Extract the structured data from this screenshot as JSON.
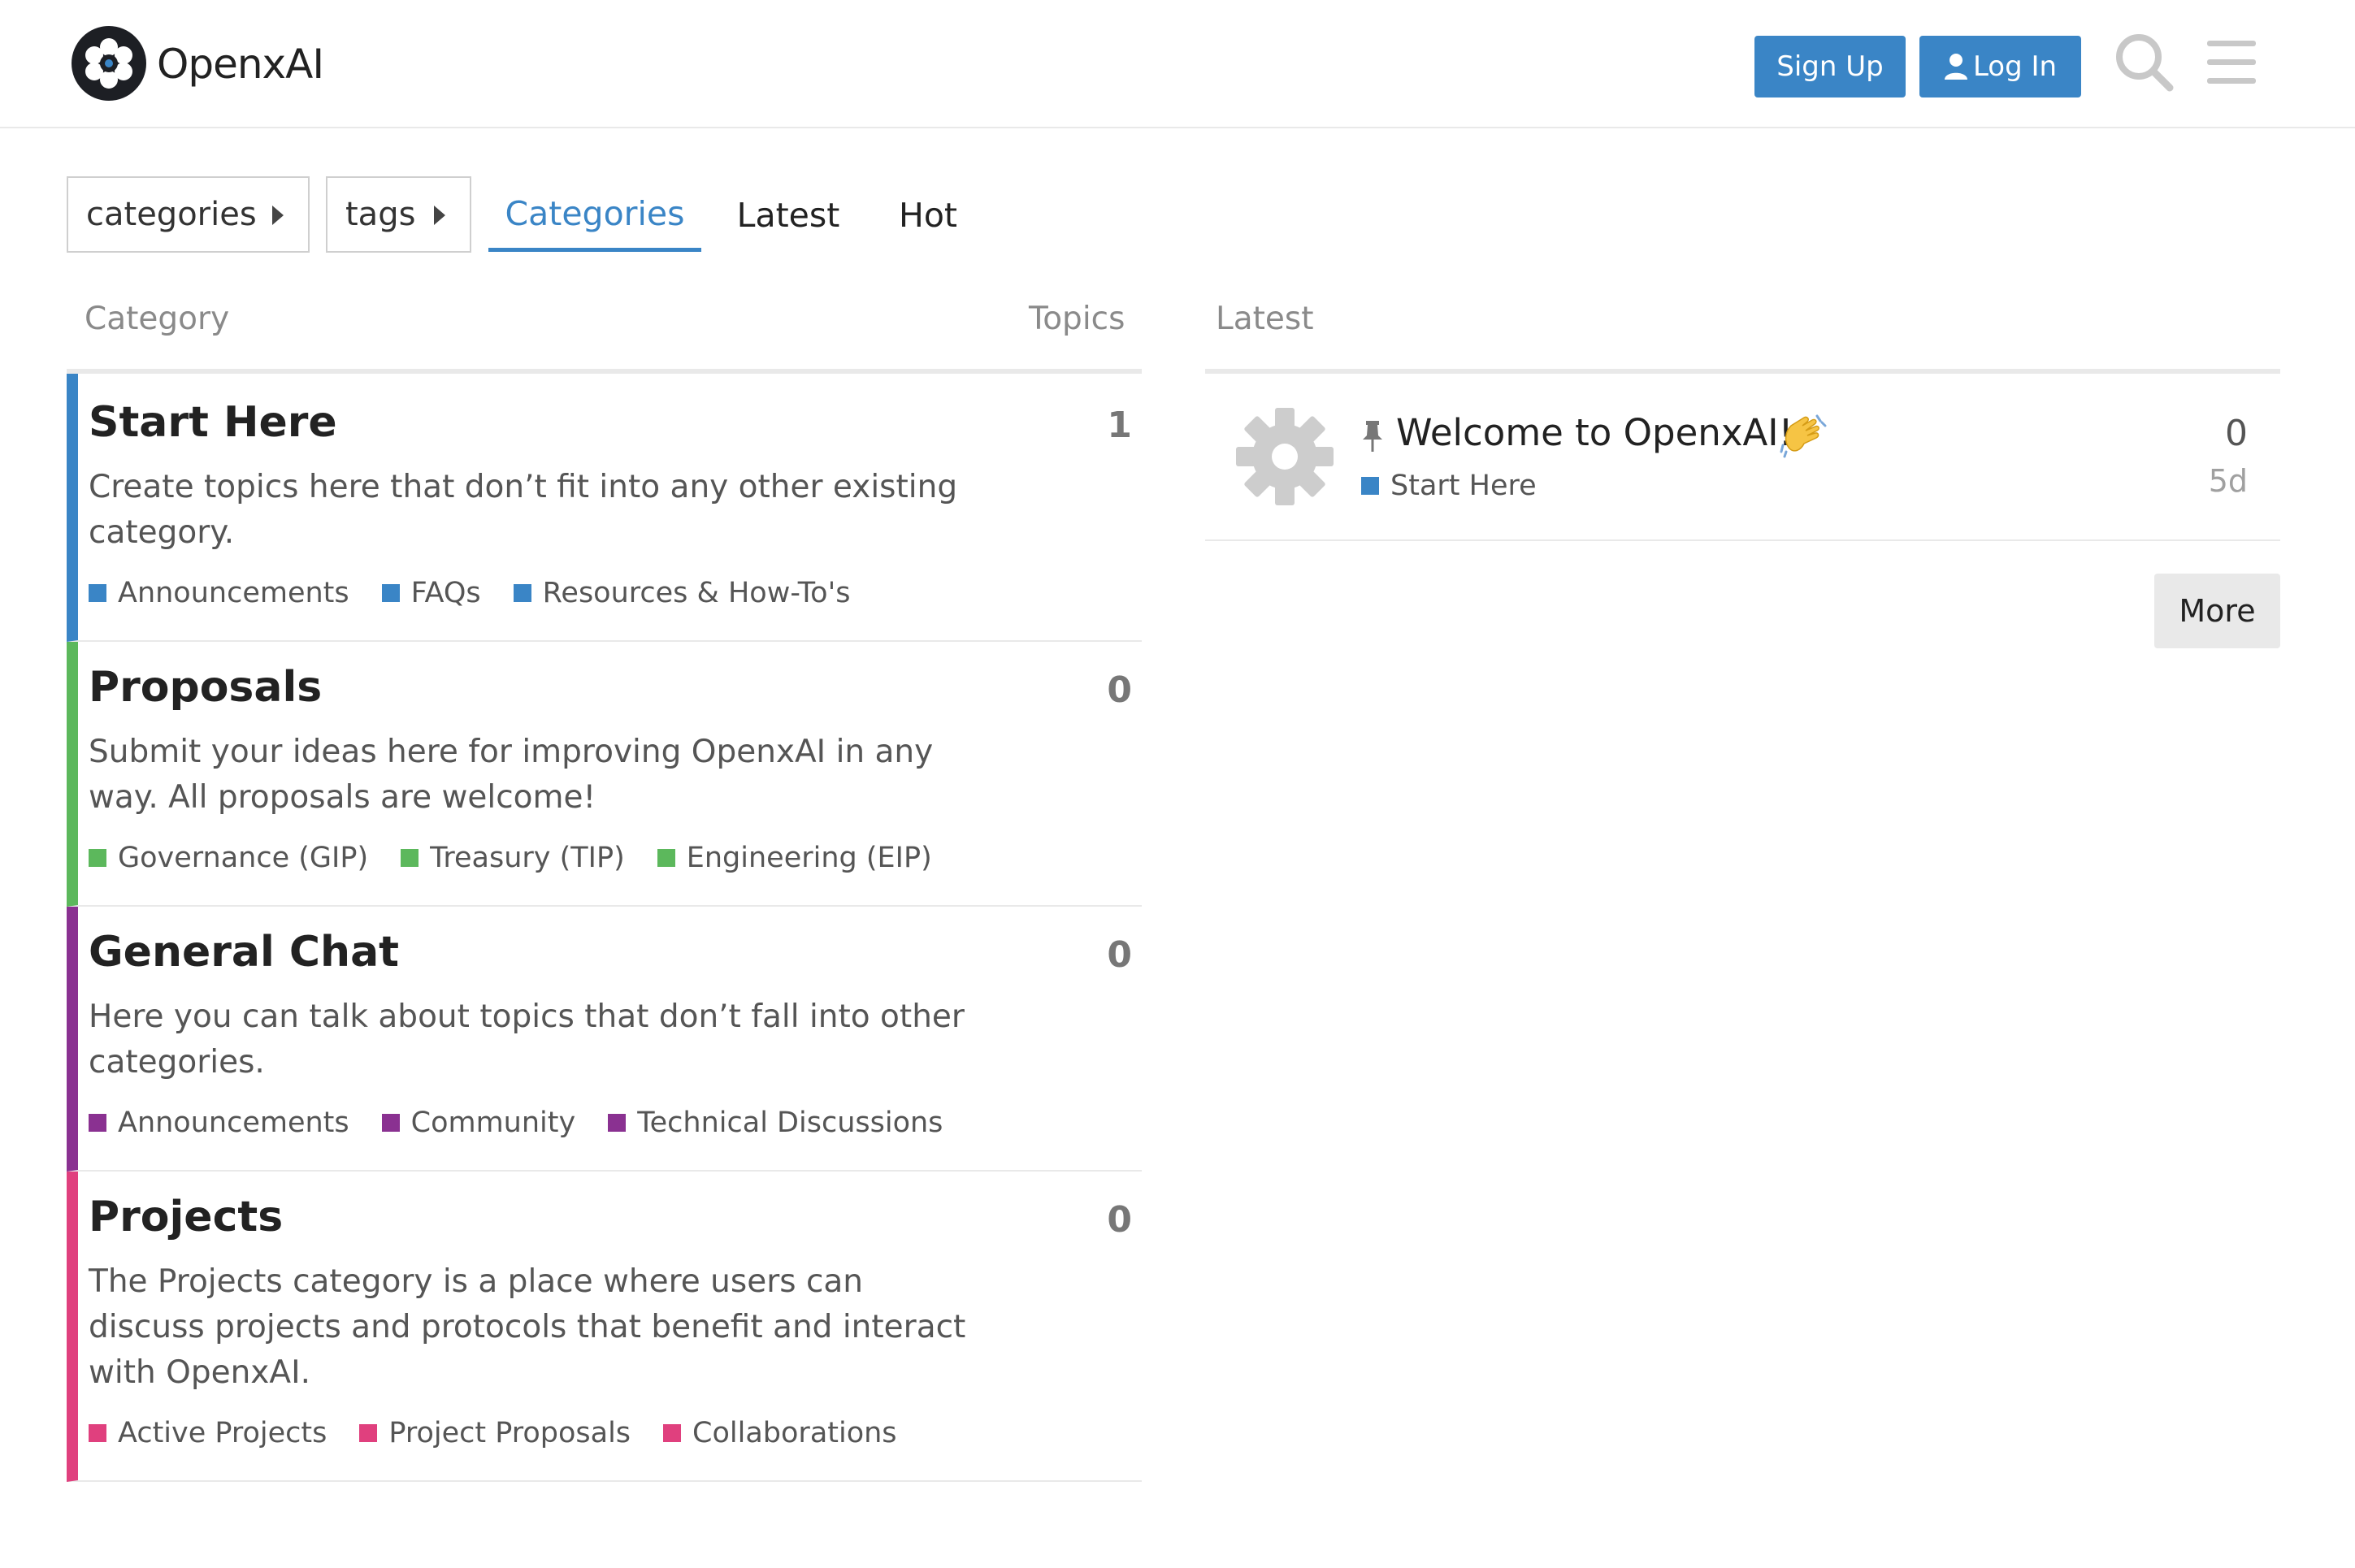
{
  "header": {
    "site_name": "OpenxAI",
    "signup_label": "Sign Up",
    "login_label": "Log In",
    "accent_color": "#3a85c6"
  },
  "nav": {
    "categories_dropdown": "categories",
    "tags_dropdown": "tags",
    "tabs": [
      {
        "label": "Categories",
        "active": true
      },
      {
        "label": "Latest",
        "active": false
      },
      {
        "label": "Hot",
        "active": false
      }
    ]
  },
  "table": {
    "head_category": "Category",
    "head_topics": "Topics",
    "head_latest": "Latest"
  },
  "categories": [
    {
      "name": "Start Here",
      "topics": "1",
      "color": "#3a85c6",
      "description": "Create topics here that don’t fit into any other existing category.",
      "subcategories": [
        "Announcements",
        "FAQs",
        "Resources & How-To's"
      ]
    },
    {
      "name": "Proposals",
      "topics": "0",
      "color": "#5cb85c",
      "description": "Submit your ideas here for improving OpenxAI in any way. All proposals are welcome!",
      "subcategories": [
        "Governance (GIP)",
        "Treasury (TIP)",
        "Engineering (EIP)"
      ]
    },
    {
      "name": "General Chat",
      "topics": "0",
      "color": "#8a3191",
      "description": "Here you can talk about topics that don’t fall into other categories.",
      "subcategories": [
        "Announcements",
        "Community",
        "Technical Discussions"
      ]
    },
    {
      "name": "Projects",
      "topics": "0",
      "color": "#e0407e",
      "description": "The Projects category is a place where users can discuss projects and protocols that benefit and interact with OpenxAI.",
      "subcategories": [
        "Active Projects",
        "Project Proposals",
        "Collaborations"
      ]
    }
  ],
  "latest_topic": {
    "title": "Welcome to OpenxAI!",
    "category": "Start Here",
    "category_color": "#3a85c6",
    "replies": "0",
    "age": "5d",
    "icons": [
      "pin-icon",
      "waving-hand-icon",
      "gear-avatar-icon"
    ]
  },
  "more_label": "More"
}
